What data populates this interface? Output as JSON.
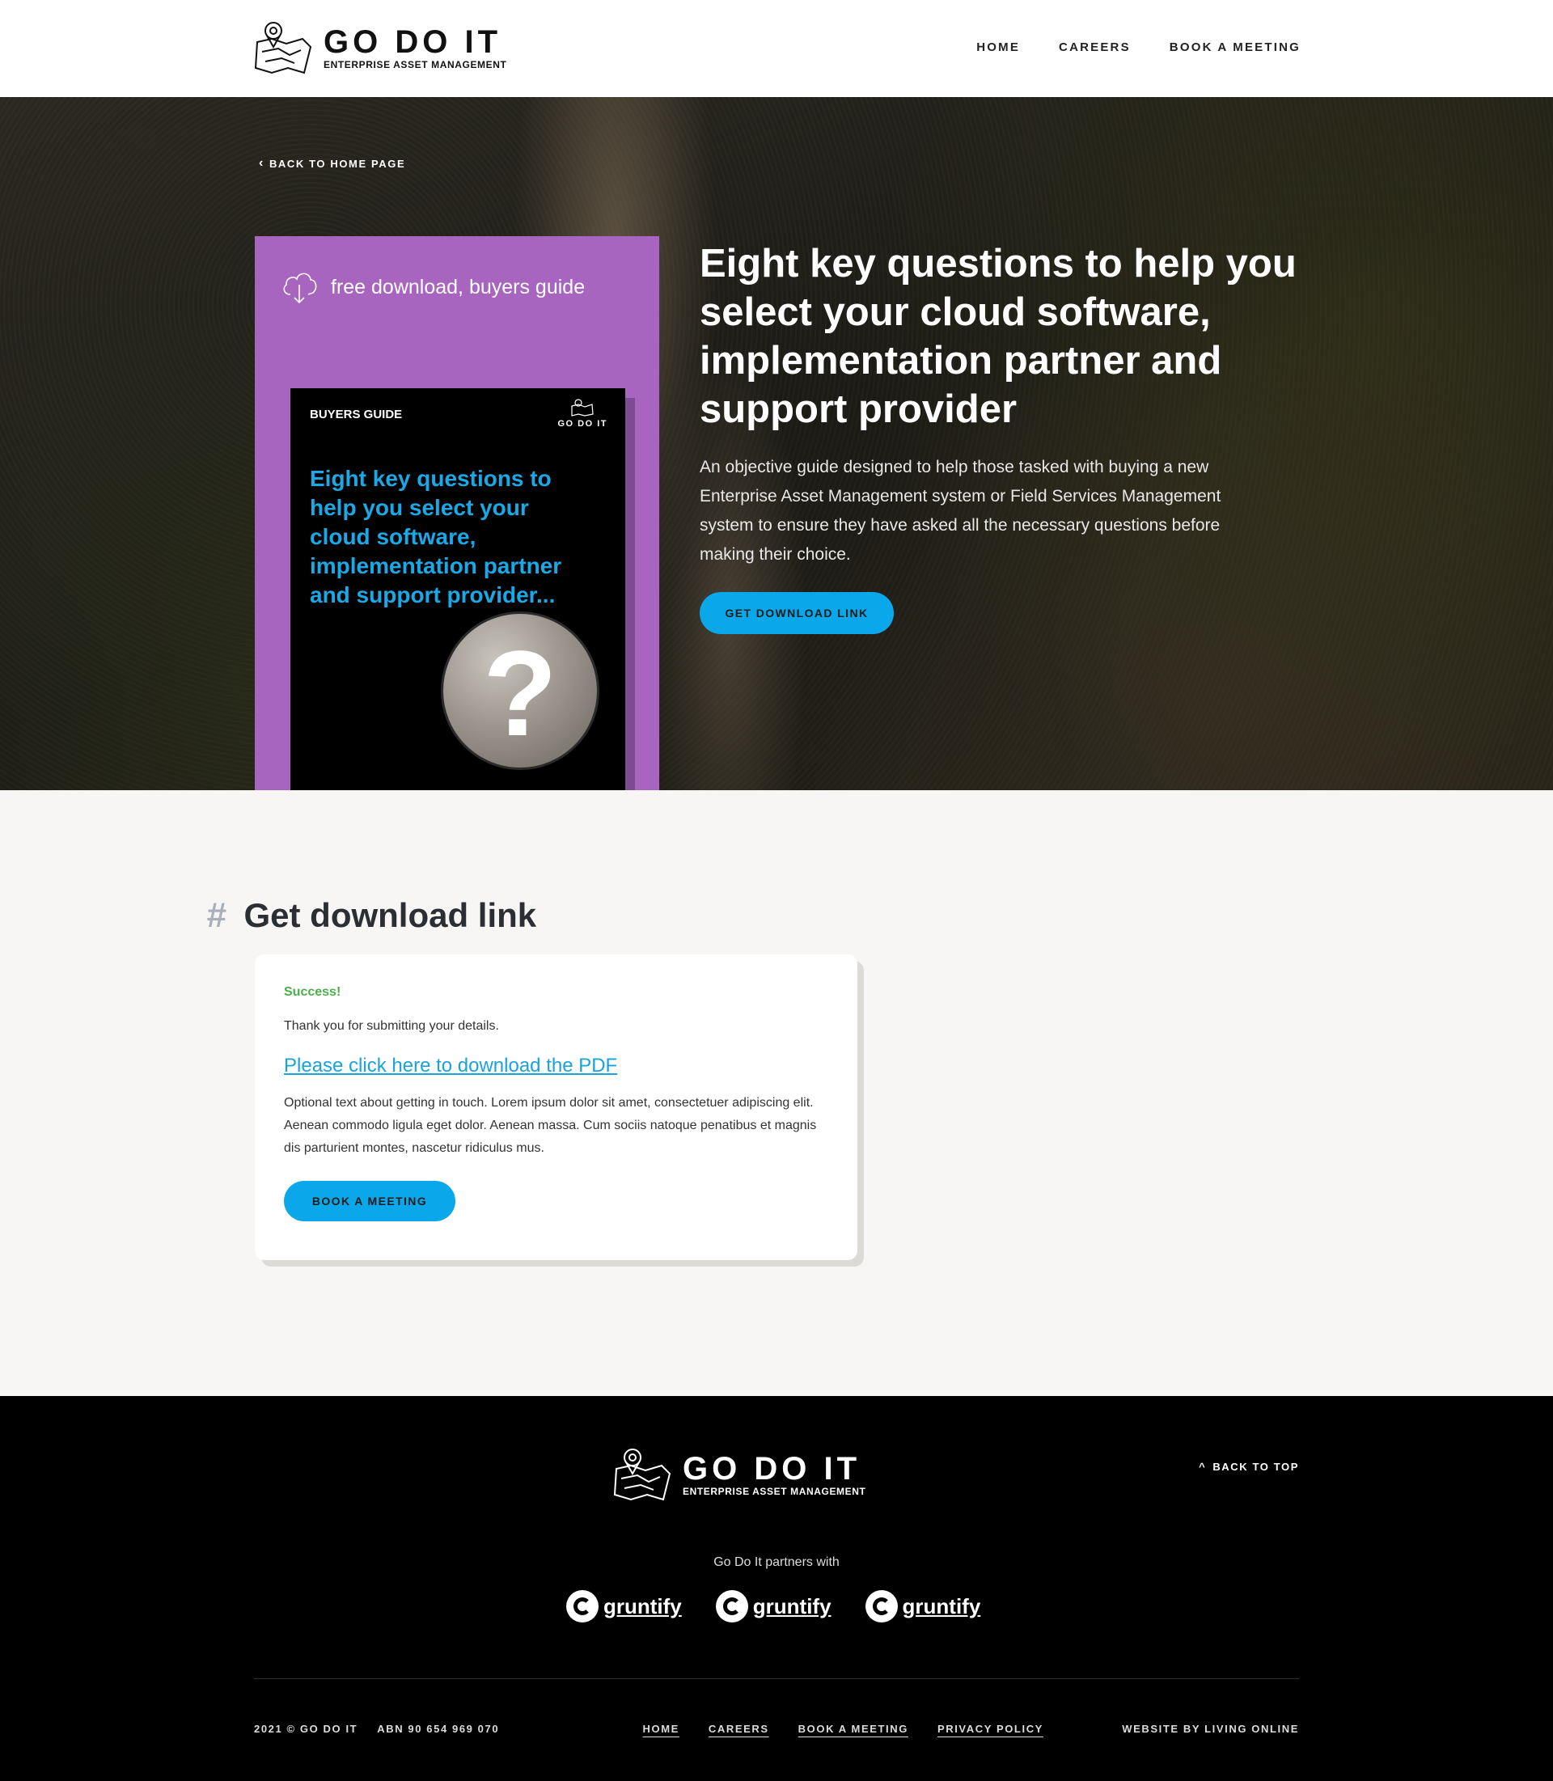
{
  "header": {
    "logo_title": "GO DO IT",
    "logo_subtitle": "ENTERPRISE ASSET MANAGEMENT",
    "nav": [
      "HOME",
      "CAREERS",
      "BOOK A MEETING"
    ]
  },
  "hero": {
    "back_link": "BACK TO HOME PAGE",
    "tag": "free download, buyers guide",
    "book_label": "BUYERS GUIDE",
    "book_logo": "GO DO IT",
    "book_title": "Eight key questions to help you select your cloud software, implementation partner and support provider...",
    "book_circle_glyph": "?",
    "title": "Eight key questions to help you select your cloud software, implementation partner and support provider",
    "description": "An objective guide designed to help those tasked with buying a new Enterprise Asset Management system or Field Services Management system to ensure they have asked all the necessary questions before making their choice.",
    "button": "GET DOWNLOAD LINK",
    "colors": {
      "panel": "#a765bf",
      "accent": "#0aa8ea",
      "book_title": "#19a9e6"
    }
  },
  "download": {
    "hash": "#",
    "heading": "Get download link",
    "success": "Success!",
    "thanks": "Thank you for submitting your details.",
    "link_text": "Please click here to download the PDF",
    "optional_text": "Optional text about getting in touch. Lorem ipsum dolor sit amet, consectetuer adipiscing elit. Aenean commodo ligula eget dolor. Aenean massa. Cum sociis natoque penatibus et magnis dis parturient montes, nascetur ridiculus mus.",
    "button": "BOOK A MEETING"
  },
  "footer": {
    "logo_title": "GO DO IT",
    "logo_subtitle": "ENTERPRISE ASSET MANAGEMENT",
    "back_top": "BACK TO TOP",
    "partners_label": "Go Do It partners with",
    "partners": [
      "gruntify",
      "gruntify",
      "gruntify"
    ],
    "copyright": "2021 © GO DO IT",
    "abn": "ABN 90 654 969 070",
    "nav": [
      "HOME",
      "CAREERS",
      "BOOK A MEETING",
      "PRIVACY POLICY"
    ],
    "credit": "WEBSITE BY LIVING ONLINE"
  }
}
